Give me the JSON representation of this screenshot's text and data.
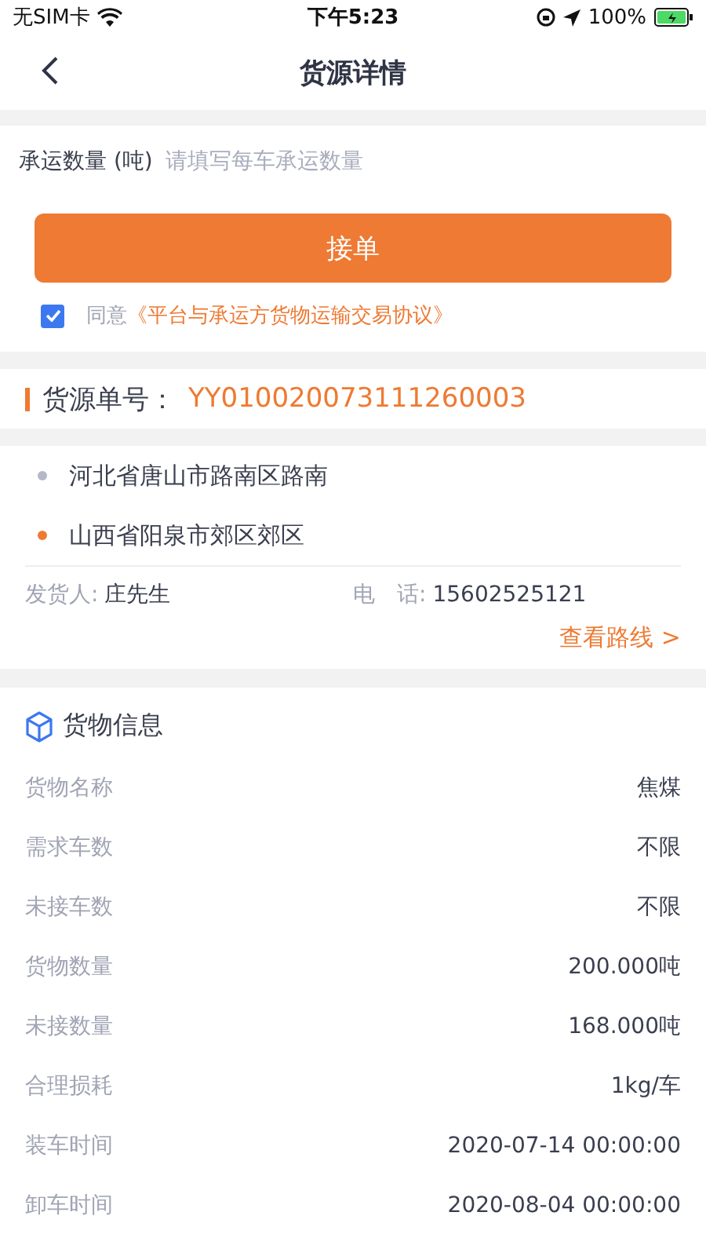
{
  "status_bar": {
    "carrier": "无SIM卡",
    "time": "下午5:23",
    "battery": "100%"
  },
  "nav": {
    "title": "货源详情"
  },
  "form": {
    "label": "承运数量 (吨)",
    "placeholder": "请填写每车承运数量",
    "button": "接单",
    "agree": {
      "checked": true,
      "text": "同意",
      "link": "《平台与承运方货物运输交易协议》"
    }
  },
  "order": {
    "label": "货源单号：",
    "number": "YY010020073111260003"
  },
  "route": {
    "stops": [
      {
        "address": "河北省唐山市路南区路南",
        "color": "#b4b8c8"
      },
      {
        "address": "山西省阳泉市郊区郊区",
        "color": "#ee7a33"
      }
    ],
    "shipper_label": "发货人:",
    "shipper": "庄先生",
    "phone_label": "电　话:",
    "phone": "15602525121",
    "view_route": "查看路线 >"
  },
  "cargo": {
    "title": "货物信息",
    "rows": [
      {
        "label": "货物名称",
        "value": "焦煤"
      },
      {
        "label": "需求车数",
        "value": "不限"
      },
      {
        "label": "未接车数",
        "value": "不限"
      },
      {
        "label": "货物数量",
        "value": "200.000吨"
      },
      {
        "label": "未接数量",
        "value": "168.000吨"
      },
      {
        "label": "合理损耗",
        "value": "1kg/车"
      },
      {
        "label": "装车时间",
        "value": "2020-07-14 00:00:00"
      },
      {
        "label": "卸车时间",
        "value": "2020-08-04 00:00:00"
      }
    ]
  }
}
